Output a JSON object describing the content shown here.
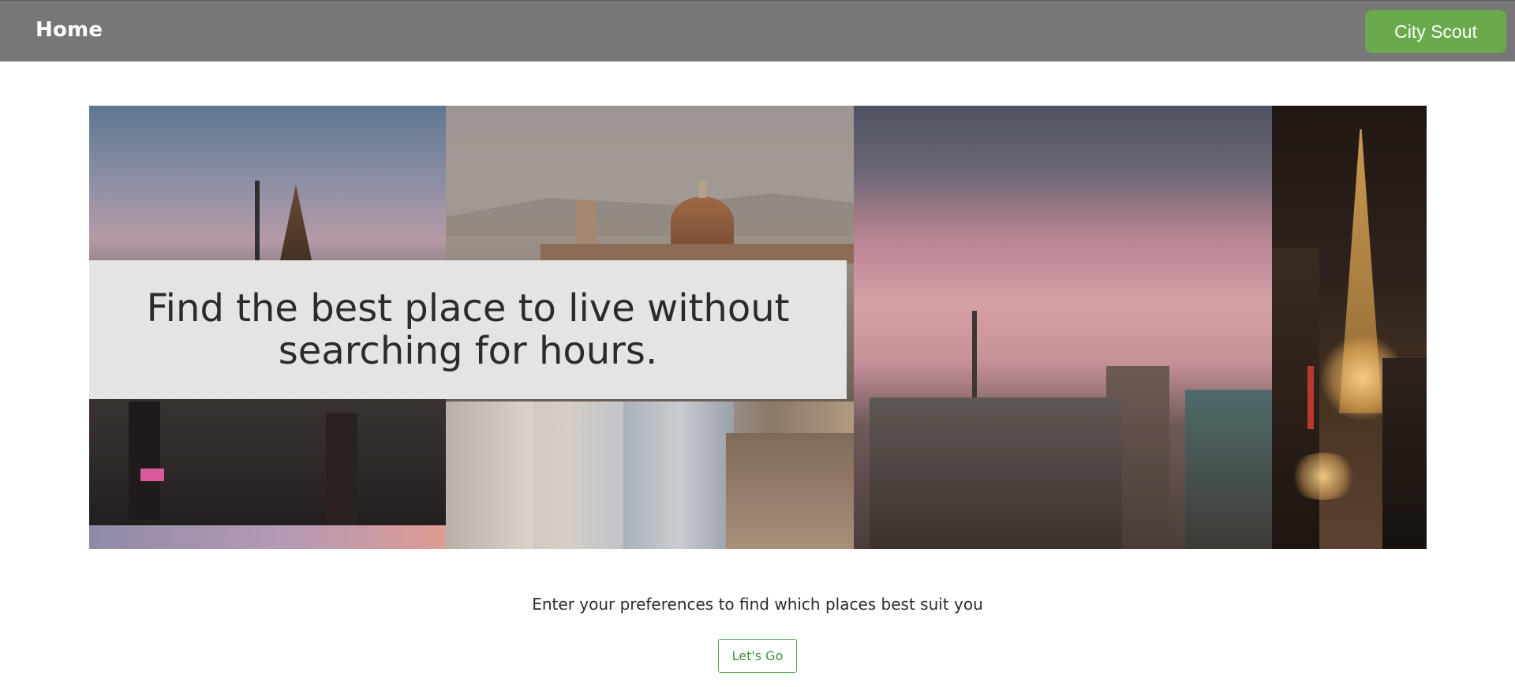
{
  "navbar": {
    "home_label": "Home",
    "brand_label": "City Scout",
    "brand_color": "#6aaa4c",
    "background_color": "#777777"
  },
  "hero": {
    "title": "Find the best place to live without searching for hours."
  },
  "cta": {
    "prompt": "Enter your preferences to find which places best suit you",
    "button_label": "Let's Go",
    "button_color": "#4ea64e"
  }
}
